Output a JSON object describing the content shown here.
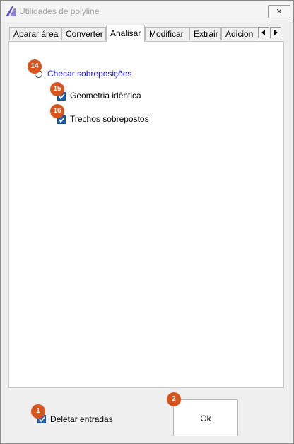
{
  "window": {
    "title": "Utilidades de polyline",
    "close_label": "✕"
  },
  "tabs": [
    {
      "label": "Aparar área",
      "active": false
    },
    {
      "label": "Converter",
      "active": false
    },
    {
      "label": "Analisar",
      "active": true
    },
    {
      "label": "Modificar",
      "active": false
    },
    {
      "label": "Extrair",
      "active": false
    },
    {
      "label": "Adicion",
      "active": false
    }
  ],
  "panel": {
    "check_overlaps": {
      "label": "Checar sobreposições",
      "badge": "14",
      "selected": false
    },
    "identical_geometry": {
      "label": "Geometria idêntica",
      "badge": "15",
      "checked": true
    },
    "overlapping_segments": {
      "label": "Trechos sobrepostos",
      "badge": "16",
      "checked": true
    }
  },
  "footer": {
    "delete_inputs": {
      "label": "Deletar entradas",
      "badge": "1",
      "checked": true
    },
    "ok": {
      "label": "Ok",
      "badge": "2"
    }
  },
  "colors": {
    "badge": "#d9541d",
    "checkbox": "#1d5fb4",
    "link_text": "#1a1adf"
  }
}
